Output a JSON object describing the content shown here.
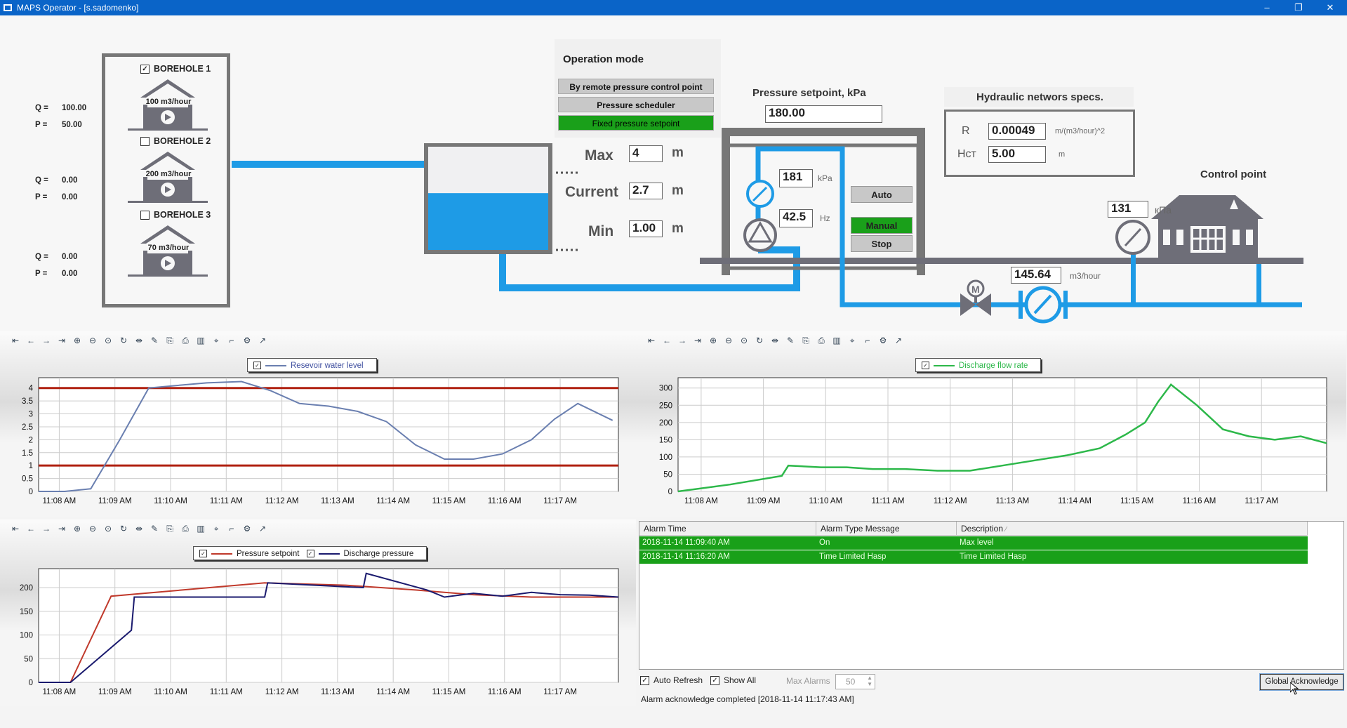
{
  "window": {
    "title": "MAPS Operator - [s.sadomenko]",
    "minimize": "–",
    "restore": "❐",
    "close": "✕"
  },
  "boreholes": [
    {
      "label": "BOREHOLE 1",
      "checked": true,
      "capacity": "100 m3/hour",
      "q_label": "Q =",
      "q": "100.00",
      "p_label": "P =",
      "p": "50.00"
    },
    {
      "label": "BOREHOLE 2",
      "checked": false,
      "capacity": "200 m3/hour",
      "q_label": "Q =",
      "q": "0.00",
      "p_label": "P =",
      "p": "0.00"
    },
    {
      "label": "BOREHOLE 3",
      "checked": false,
      "capacity": "70 m3/hour",
      "q_label": "Q =",
      "q": "0.00",
      "p_label": "P =",
      "p": "0.00"
    }
  ],
  "operation_mode": {
    "title": "Operation mode",
    "options": [
      "By remote pressure control point",
      "Pressure scheduler",
      "Fixed pressure setpoint"
    ],
    "active": "Fixed pressure setpoint",
    "active_color": "#1aa01a"
  },
  "reservoir": {
    "max_label": "Max",
    "max": "4",
    "current_label": "Current",
    "current": "2.7",
    "min_label": "Min",
    "min": "1.00",
    "unit": "m",
    "fill_fraction": 0.55
  },
  "pressure_setpoint": {
    "label": "Pressure setpoint, kPa",
    "value": "180.00"
  },
  "pump": {
    "pressure": "181",
    "pressure_unit": "kPa",
    "frequency": "42.5",
    "frequency_unit": "Hz",
    "buttons": [
      "Auto",
      "Manual",
      "Stop"
    ],
    "active": "Manual"
  },
  "hydraulic": {
    "title": "Hydraulic networs specs.",
    "r_label": "R",
    "r_value": "0.00049",
    "r_unit": "m/(m3/hour)^2",
    "h_label": "Нст",
    "h_value": "5.00",
    "h_unit": "m"
  },
  "control_point": {
    "title": "Control point",
    "pressure": "131",
    "pressure_unit": "кПа"
  },
  "flowmeter": {
    "value": "145.64",
    "unit": "m3/hour",
    "valve_label": "M"
  },
  "colors": {
    "pipe": "#1e9be6",
    "machinery": "#6e6e78",
    "active": "#1aa01a",
    "titlebar": "#0a64c8"
  },
  "toolbar_icons": [
    "first-icon",
    "prev-icon",
    "next-icon",
    "last-icon",
    "zoom-in-icon",
    "zoom-out-icon",
    "zoom-fit-icon",
    "refresh-icon",
    "pan-icon",
    "edit-icon",
    "export-icon",
    "print-icon",
    "chart-type-icon",
    "cursor-icon",
    "axis-icon",
    "settings-icon",
    "trend-icon"
  ],
  "chart_data": [
    {
      "type": "line",
      "legend": [
        "Resevoir water level"
      ],
      "x_ticks": [
        "11:08 AM",
        "11:09 AM",
        "11:10 AM",
        "11:11 AM",
        "11:12 AM",
        "11:13 AM",
        "11:14 AM",
        "11:15 AM",
        "11:16 AM",
        "11:17 AM"
      ],
      "y_ticks": [
        "0",
        "0.5",
        "1",
        "1.5",
        "2",
        "2.5",
        "3",
        "3.5",
        "4"
      ],
      "ylim": [
        0,
        4.4
      ],
      "xlim": [
        0,
        10
      ],
      "series": [
        {
          "name": "Resevoir water level",
          "color": "#6a7fb0",
          "x": [
            0,
            0.45,
            0.9,
            1.4,
            1.9,
            2.4,
            2.9,
            3.5,
            4.0,
            4.5,
            5.0,
            5.5,
            6.0,
            6.5,
            7.0,
            7.5,
            8.0,
            8.5,
            8.9,
            9.3,
            9.9
          ],
          "y": [
            0,
            0,
            0.1,
            2.0,
            4.0,
            4.1,
            4.2,
            4.25,
            3.9,
            3.4,
            3.3,
            3.1,
            2.7,
            1.8,
            1.25,
            1.25,
            1.45,
            2.0,
            2.8,
            3.4,
            2.75
          ]
        }
      ],
      "limits": [
        {
          "value": 4,
          "color": "#b02010"
        },
        {
          "value": 1,
          "color": "#b02010"
        }
      ]
    },
    {
      "type": "line",
      "legend": [
        "Discharge flow rate"
      ],
      "x_ticks": [
        "11:08 AM",
        "11:09 AM",
        "11:10 AM",
        "11:11 AM",
        "11:12 AM",
        "11:13 AM",
        "11:14 AM",
        "11:15 AM",
        "11:16 AM",
        "11:17 AM"
      ],
      "y_ticks": [
        "0",
        "50",
        "100",
        "150",
        "200",
        "250",
        "300"
      ],
      "ylim": [
        0,
        330
      ],
      "xlim": [
        0,
        10
      ],
      "series": [
        {
          "name": "Discharge flow rate",
          "color": "#2db84a",
          "x": [
            0,
            0.8,
            1.6,
            1.7,
            2.2,
            2.6,
            3.0,
            3.5,
            4.0,
            4.5,
            5.0,
            5.5,
            6.0,
            6.5,
            6.9,
            7.2,
            7.4,
            7.6,
            8.0,
            8.4,
            8.8,
            9.2,
            9.6,
            10
          ],
          "y": [
            0,
            20,
            45,
            75,
            70,
            70,
            65,
            65,
            60,
            60,
            75,
            90,
            105,
            125,
            165,
            200,
            260,
            310,
            250,
            180,
            160,
            150,
            160,
            140
          ]
        }
      ]
    },
    {
      "type": "line",
      "legend": [
        "Pressure setpoint",
        "Discharge pressure"
      ],
      "x_ticks": [
        "11:08 AM",
        "11:09 AM",
        "11:10 AM",
        "11:11 AM",
        "11:12 AM",
        "11:13 AM",
        "11:14 AM",
        "11:15 AM",
        "11:16 AM",
        "11:17 AM"
      ],
      "y_ticks": [
        "0",
        "50",
        "100",
        "150",
        "200"
      ],
      "ylim": [
        0,
        240
      ],
      "xlim": [
        0,
        10
      ],
      "series": [
        {
          "name": "Pressure setpoint",
          "color": "#c0392b",
          "x": [
            0,
            0.55,
            1.25,
            3.9,
            5.3,
            6.5,
            7.5,
            8.5,
            10
          ],
          "y": [
            0,
            0,
            182,
            210,
            205,
            195,
            185,
            180,
            180
          ]
        },
        {
          "name": "Discharge pressure",
          "color": "#1a1a6e",
          "x": [
            0,
            0.55,
            1.6,
            1.65,
            3.9,
            3.95,
            5.6,
            5.65,
            6.7,
            7.0,
            7.5,
            8.0,
            8.5,
            9.0,
            9.5,
            10
          ],
          "y": [
            0,
            0,
            110,
            180,
            180,
            210,
            200,
            230,
            195,
            180,
            188,
            182,
            190,
            185,
            184,
            180
          ]
        }
      ]
    }
  ],
  "alarm": {
    "columns": [
      "Alarm Time",
      "Alarm Type Message",
      "Description"
    ],
    "rows": [
      {
        "time": "2018-11-14 11:09:40 AM",
        "type": "On",
        "desc": "Max level"
      },
      {
        "time": "2018-11-14 11:16:20 AM",
        "type": "Time Limited Hasp",
        "desc": "Time Limited Hasp"
      }
    ],
    "auto_refresh": "Auto Refresh",
    "show_all": "Show All",
    "max_alarms_label": "Max Alarms",
    "max_alarms": "50",
    "ack_button": "Global Acknowledge",
    "status": "Alarm acknowledge completed [2018-11-14 11:17:43 AM]"
  }
}
